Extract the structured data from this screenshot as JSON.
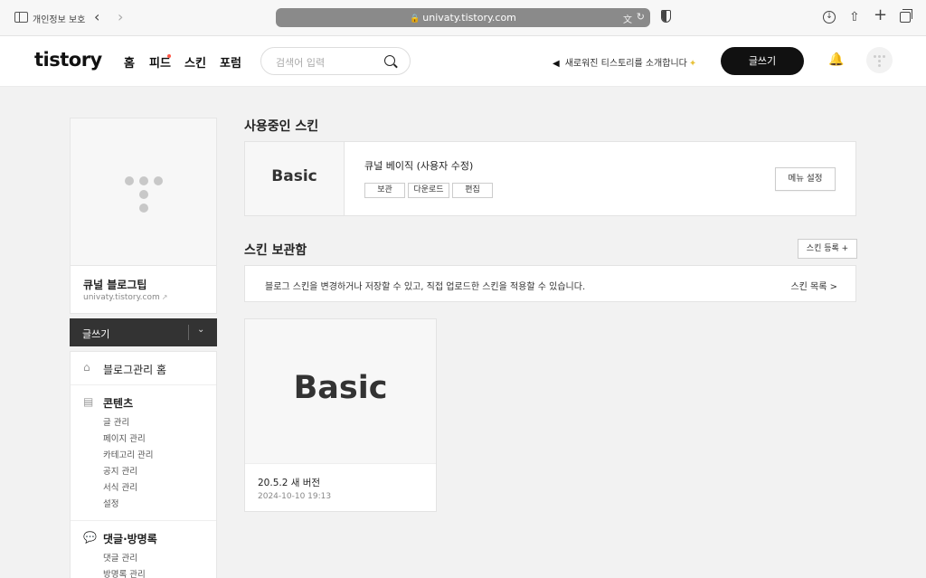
{
  "browser": {
    "privacy_label": "개인정보 보호",
    "url": "univaty.tistory.com"
  },
  "header": {
    "logo": "tistory",
    "nav": [
      "홈",
      "피드",
      "스킨",
      "포럼"
    ],
    "search_placeholder": "검색어 입력",
    "notice": "새로워진 티스토리를 소개합니다",
    "write_label": "글쓰기"
  },
  "sidebar": {
    "blog_name": "큐널 블로그팁",
    "blog_url": "univaty.tistory.com",
    "write_label": "글쓰기",
    "home_label": "블로그관리 홈",
    "contents_title": "콘텐츠",
    "contents_items": [
      "글 관리",
      "페이지 관리",
      "카테고리 관리",
      "공지 관리",
      "서식 관리",
      "설정"
    ],
    "comments_title": "댓글·방명록",
    "comments_items": [
      "댓글 관리",
      "방명록 관리"
    ]
  },
  "main": {
    "using_title": "사용중인 스킨",
    "using_skin": {
      "thumb": "Basic",
      "name": "큐널 베이직 (사용자 수정)",
      "buttons": [
        "보관",
        "다운로드",
        "편집"
      ],
      "menu_setting": "메뉴 설정"
    },
    "storage_title": "스킨 보관함",
    "register_label": "스킨 등록 +",
    "info_text": "블로그 스킨을 변경하거나 저장할 수 있고, 직접 업로드한 스킨을 적용할 수 있습니다.",
    "skin_list_label": "스킨 목록 >",
    "stored_skin": {
      "thumb": "Basic",
      "version": "20.5.2 새 버전",
      "date": "2024-10-10 19:13"
    }
  }
}
